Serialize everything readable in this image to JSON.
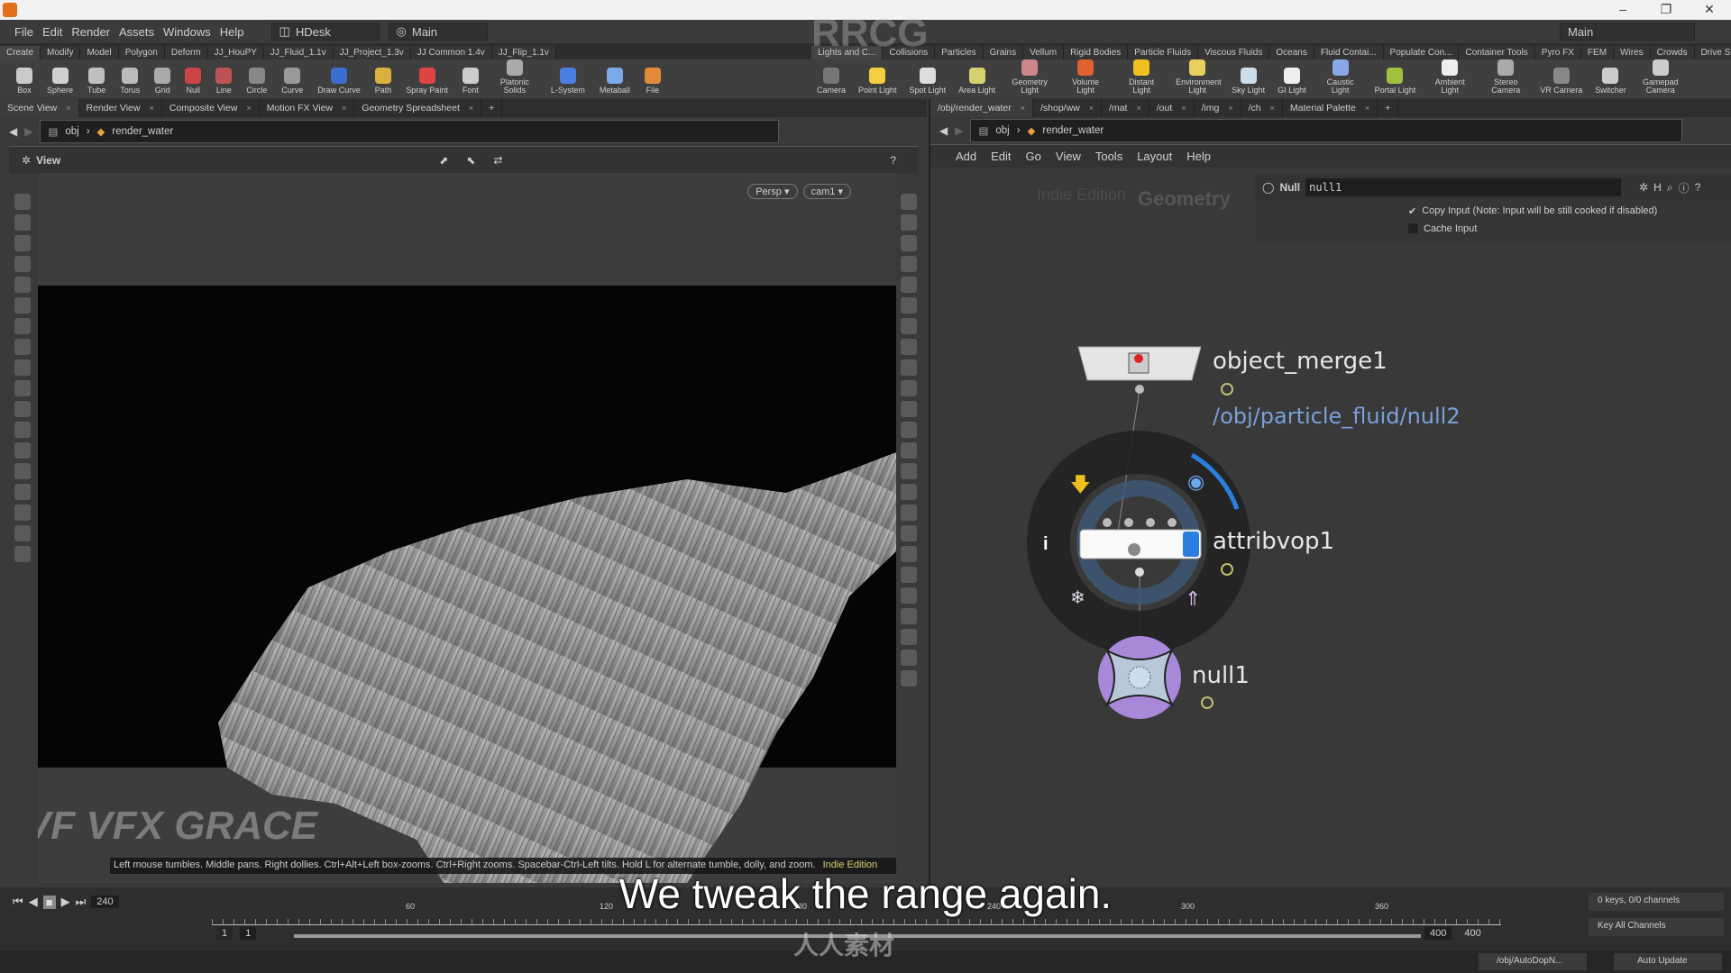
{
  "titlebar": {
    "controls": [
      "–",
      "❐",
      "✕"
    ]
  },
  "menu": {
    "items": [
      "File",
      "Edit",
      "Render",
      "Assets",
      "Windows",
      "Help"
    ],
    "desktop": "HDesk",
    "desktop_sub": "Main",
    "right_desktop": "Main"
  },
  "shelf_left": {
    "tabs": [
      "Create",
      "Modify",
      "Model",
      "Polygon",
      "Deform",
      "JJ_HouPY",
      "JJ_Fluid_1.1v",
      "JJ_Project_1.3v",
      "JJ Common 1.4v",
      "JJ_Flip_1.1v"
    ],
    "tools": [
      {
        "label": "Box",
        "color": "#c9c9c9"
      },
      {
        "label": "Sphere",
        "color": "#d0d0d0"
      },
      {
        "label": "Tube",
        "color": "#c0c0c0"
      },
      {
        "label": "Torus",
        "color": "#bbbbbb"
      },
      {
        "label": "Grid",
        "color": "#aaaaaa"
      },
      {
        "label": "Null",
        "color": "#c44"
      },
      {
        "label": "Line",
        "color": "#b55"
      },
      {
        "label": "Circle",
        "color": "#888"
      },
      {
        "label": "Curve",
        "color": "#999"
      },
      {
        "label": "Draw Curve",
        "color": "#3a6fd0"
      },
      {
        "label": "Path",
        "color": "#d9b040"
      },
      {
        "label": "Spray Paint",
        "color": "#d44"
      },
      {
        "label": "Font",
        "color": "#ccc"
      },
      {
        "label": "Platonic Solids",
        "color": "#aaa"
      },
      {
        "label": "L-System",
        "color": "#4a7fe0"
      },
      {
        "label": "Metaball",
        "color": "#7aaae8"
      },
      {
        "label": "File",
        "color": "#e08a3a"
      }
    ]
  },
  "shelf_right": {
    "tabs": [
      "Lights and C...",
      "Collisions",
      "Particles",
      "Grains",
      "Vellum",
      "Rigid Bodies",
      "Particle Fluids",
      "Viscous Fluids",
      "Oceans",
      "Fluid Contai...",
      "Populate Con...",
      "Container Tools",
      "Pyro FX",
      "FEM",
      "Wires",
      "Crowds",
      "Drive Simula..."
    ],
    "tools": [
      {
        "label": "Camera",
        "color": "#777"
      },
      {
        "label": "Point Light",
        "color": "#f0d040"
      },
      {
        "label": "Spot Light",
        "color": "#ddd"
      },
      {
        "label": "Area Light",
        "color": "#d8d070"
      },
      {
        "label": "Geometry Light",
        "color": "#c88"
      },
      {
        "label": "Volume Light",
        "color": "#e06030"
      },
      {
        "label": "Distant Light",
        "color": "#f0c020"
      },
      {
        "label": "Environment Light",
        "color": "#e8d060"
      },
      {
        "label": "Sky Light",
        "color": "#cde"
      },
      {
        "label": "GI Light",
        "color": "#eee"
      },
      {
        "label": "Caustic Light",
        "color": "#88a8e8"
      },
      {
        "label": "Portal Light",
        "color": "#a0c040"
      },
      {
        "label": "Ambient Light",
        "color": "#eee"
      },
      {
        "label": "Stereo Camera",
        "color": "#aaa"
      },
      {
        "label": "VR Camera",
        "color": "#888"
      },
      {
        "label": "Switcher",
        "color": "#ccc"
      },
      {
        "label": "Gamepad Camera",
        "color": "#ccc"
      }
    ]
  },
  "left_pane": {
    "tabs": [
      "Scene View",
      "Render View",
      "Composite View",
      "Motion FX View",
      "Geometry Spreadsheet"
    ],
    "path": [
      "obj",
      "render_water"
    ],
    "view_label": "View",
    "persp": "Persp ▾",
    "cam": "cam1 ▾",
    "status": "Left mouse tumbles. Middle pans. Right dollies. Ctrl+Alt+Left box-zooms. Ctrl+Right zooms. Spacebar-Ctrl-Left tilts. Hold L for alternate tumble, dolly, and zoom.",
    "edition": "Indie Edition"
  },
  "right_pane": {
    "tabs": [
      "/obj/render_water",
      "/shop/ww",
      "/mat",
      "/out",
      "/img",
      "/ch",
      "Material Palette"
    ],
    "path": [
      "obj",
      "render_water"
    ],
    "menu": [
      "Add",
      "Edit",
      "Go",
      "View",
      "Tools",
      "Layout",
      "Help"
    ],
    "params": {
      "type": "Null",
      "name": "null1",
      "copy_input": "Copy Input (Note: Input will be still cooked if disabled)",
      "copy_checked": true,
      "cache_input": "Cache Input",
      "cache_checked": false
    },
    "watermark_edition": "Indie Edition",
    "watermark_context": "Geometry"
  },
  "network": {
    "nodes": [
      {
        "name": "object_merge1",
        "sub": "/obj/particle_fluid/null2"
      },
      {
        "name": "attribvop1"
      },
      {
        "name": "null1"
      }
    ],
    "accent": "#2b7de0"
  },
  "timeline": {
    "frame": "240",
    "ticks": [
      "60",
      "120",
      "180",
      "240",
      "300",
      "360"
    ],
    "start": "1",
    "start2": "1",
    "end": "400",
    "end2": "400",
    "keys": "0 keys, 0/0 channels",
    "key_all": "Key All Channels",
    "path": "/obj/AutoDopN...",
    "update": "Auto Update"
  },
  "subtitle": "We tweak the range again.",
  "watermarks": {
    "brand": "VFX GRACE",
    "site": "人人素材",
    "rrcg": "RRCG"
  }
}
